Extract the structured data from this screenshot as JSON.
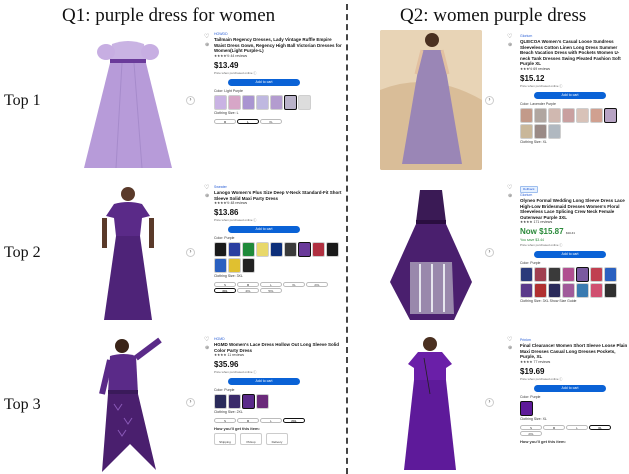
{
  "headings": {
    "q1": "Q1: purple dress for women",
    "q2": "Q2: women  purple dress"
  },
  "rows": [
    "Top 1",
    "Top 2",
    "Top 3"
  ],
  "colors": {
    "purple_light": "#b79bd9",
    "purple_mid": "#7a4aa8",
    "purple_dark": "#4a1f6e",
    "buy_blue": "#0a62d6"
  },
  "q1": [
    {
      "brand": "HOWDD",
      "title": "Tailmain Regency Dresses, Lady Vintage Ruffle Empire Waist Dress Gown, Regency High Ball Victorian Dresses for Women(Light Purple-L)",
      "stars": "★★★★½ 44 reviews",
      "price": "$13.49",
      "note": "Price when purchased online ⓘ",
      "cart": "Add to cart",
      "color_label": "Color: Light Purple",
      "size_label": "Clothing Size: L",
      "sizes": [
        "M",
        "L",
        "XL"
      ],
      "swatches": [
        "#c9b3e3",
        "#d7a6c7",
        "#a995d1",
        "#bfb8e0",
        "#b39ccf",
        "#b9b2c9",
        "#ddd"
      ],
      "swatch_prices": [
        "$13.49",
        "$13.49",
        "$13.49",
        "$13.49",
        "$13.49",
        "$13.49"
      ]
    },
    {
      "brand": "Sweater",
      "title": "Lanogo Women's Plus Size Deep V-Neck Standard-Fit Short Sleeve Solid Maxi Party Dress",
      "stars": "★★★★½ 48 reviews",
      "price": "$13.86",
      "note": "Price when purchased online ⓘ",
      "cart": "Add to cart",
      "color_label": "Color: Purple",
      "size_label": "Clothing Size: 3XL",
      "sizes": [
        "S",
        "M",
        "L",
        "XL",
        "2XL",
        "3XL",
        "4XL",
        "5XL"
      ],
      "swatches": [
        "#1a1a1a",
        "#2a3fa0",
        "#1f8a3a",
        "#e8d86a",
        "#0d2f7a",
        "#3a3a3a",
        "#6a3a9a",
        "#b03040",
        "#1a1a1a",
        "#2a60c0",
        "#e0c030",
        "#222"
      ]
    },
    {
      "brand": "HGMD",
      "title": "HGMD Women's Lace Dress Hollow Out Long Sleeve Solid Color Party Dress",
      "stars": "★★★★ 11 reviews",
      "price": "$35.96",
      "note": "Price when purchased online ⓘ",
      "cart": "Add to cart",
      "color_label": "Color: Purple",
      "size_label": "Clothing Size: 2XL",
      "sizes": [
        "S",
        "M",
        "L",
        "2XL"
      ],
      "swatches": [
        "#2a2a5a",
        "#3a2a6a",
        "#5a2a8a",
        "#6a2a7a"
      ],
      "getit": "How you'll get this item:",
      "options": [
        "Shipping",
        "Pickup",
        "Delivery"
      ]
    }
  ],
  "q2": [
    {
      "brand": "Glorium",
      "title": "QLEICOA Women's Casual Loose Sundress Sleeveless Cotton Linen Long Dress Summer Beach Vacation Dress with Pockets Women U-neck Tank Dresses Swing Pleated Fashion Soft Purple XL",
      "stars": "★★★½ 69 reviews",
      "price": "$15.12",
      "note": "Price when purchased online ⓘ",
      "cart": "Add to cart",
      "color_label": "Color: Lavender Purple",
      "size_label": "Clothing Size: XL",
      "swatches": [
        "#c29a8a",
        "#b0a6a0",
        "#d0b8b0",
        "#c9a0a0",
        "#d8c2b8",
        "#d0a090",
        "#b7a3c3",
        "#c9b79a",
        "#9a8a86",
        "#b0b8c0"
      ]
    },
    {
      "brand": "Glorium",
      "deal": "Rollback",
      "title": "Olyneo Formal Wedding Long Sleeve Dress Lace High-Low Bridesmaid Dresses Women's Floral Sleeveless Lace Splicing Crew Neck Female Outerwear Purple 3XL",
      "stars": "★★★★ 171 reviews",
      "price": "Now $15.87",
      "was": "$19.31",
      "save": "You save $3.44",
      "note": "Price when purchased online ⓘ",
      "cart": "Add to cart",
      "color_label": "Color: Purple",
      "size_label": "Clothing Size: 3XL Show Size Guide",
      "swatches": [
        "#2a3a7a",
        "#a04050",
        "#3a3a3a",
        "#b05090",
        "#7a5aa0",
        "#c04050",
        "#2a60c0",
        "#5a3a8a",
        "#b03030",
        "#2a2a5a",
        "#a05a9a",
        "#3a7ab0",
        "#d05070",
        "#303030"
      ]
    },
    {
      "brand": "Prinkm",
      "title": "Final Clearance! Women Short Sleeve Loose Plain Maxi Dresses Casual Long Dresses Pockets, Purple, XL",
      "stars": "★★★★ 77 reviews",
      "price": "$19.69",
      "note": "Price when purchased online ⓘ",
      "cart": "Add to cart",
      "color_label": "Color: Purple",
      "size_label": "Clothing Size: XL",
      "sizes": [
        "S",
        "M",
        "L",
        "XL",
        "2XL"
      ],
      "getit": "How you'll get this item:"
    }
  ]
}
